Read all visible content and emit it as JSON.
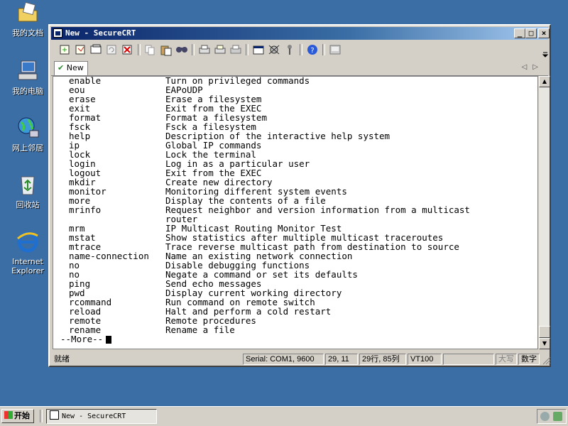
{
  "desktop": {
    "icons": [
      {
        "label": "我的文档",
        "icon": "my-documents-icon"
      },
      {
        "label": "我的电脑",
        "icon": "my-computer-icon"
      },
      {
        "label": "网上邻居",
        "icon": "network-places-icon"
      },
      {
        "label": "回收站",
        "icon": "recycle-bin-icon"
      },
      {
        "label": "Internet Explorer",
        "icon": "internet-explorer-icon"
      }
    ]
  },
  "window": {
    "title": "New - SecureCRT",
    "minimize": "_",
    "maximize": "□",
    "close": "×"
  },
  "tab": {
    "label": "New",
    "check": "✔"
  },
  "terminal": {
    "lines": [
      {
        "cmd": "enable",
        "desc": "Turn on privileged commands"
      },
      {
        "cmd": "eou",
        "desc": "EAPoUDP"
      },
      {
        "cmd": "erase",
        "desc": "Erase a filesystem"
      },
      {
        "cmd": "exit",
        "desc": "Exit from the EXEC"
      },
      {
        "cmd": "format",
        "desc": "Format a filesystem"
      },
      {
        "cmd": "fsck",
        "desc": "Fsck a filesystem"
      },
      {
        "cmd": "help",
        "desc": "Description of the interactive help system"
      },
      {
        "cmd": "ip",
        "desc": "Global IP commands"
      },
      {
        "cmd": "lock",
        "desc": "Lock the terminal"
      },
      {
        "cmd": "login",
        "desc": "Log in as a particular user"
      },
      {
        "cmd": "logout",
        "desc": "Exit from the EXEC"
      },
      {
        "cmd": "mkdir",
        "desc": "Create new directory"
      },
      {
        "cmd": "monitor",
        "desc": "Monitoring different system events"
      },
      {
        "cmd": "more",
        "desc": "Display the contents of a file"
      },
      {
        "cmd": "mrinfo",
        "desc": "Request neighbor and version information from a multicast"
      },
      {
        "cmd": "",
        "desc": "router"
      },
      {
        "cmd": "mrm",
        "desc": "IP Multicast Routing Monitor Test"
      },
      {
        "cmd": "mstat",
        "desc": "Show statistics after multiple multicast traceroutes"
      },
      {
        "cmd": "mtrace",
        "desc": "Trace reverse multicast path from destination to source"
      },
      {
        "cmd": "name-connection",
        "desc": "Name an existing network connection"
      },
      {
        "cmd": "no",
        "desc": "Disable debugging functions"
      },
      {
        "cmd": "no",
        "desc": "Negate a command or set its defaults"
      },
      {
        "cmd": "ping",
        "desc": "Send echo messages"
      },
      {
        "cmd": "pwd",
        "desc": "Display current working directory"
      },
      {
        "cmd": "rcommand",
        "desc": "Run command on remote switch"
      },
      {
        "cmd": "reload",
        "desc": "Halt and perform a cold restart"
      },
      {
        "cmd": "remote",
        "desc": "Remote procedures"
      },
      {
        "cmd": "rename",
        "desc": "Rename a file"
      }
    ],
    "more_prompt": "--More--"
  },
  "statusbar": {
    "ready": "就绪",
    "serial": "Serial: COM1, 9600",
    "cursor_pos": "29, 11",
    "rows_cols": "29行, 85列",
    "emulation": "VT100",
    "caps": "大写",
    "num": "数字"
  },
  "taskbar": {
    "start": "开始",
    "task_title": "New - SecureCRT"
  },
  "colors": {
    "desktop": "#3a6ea5",
    "titlebar": "#0a246a"
  }
}
